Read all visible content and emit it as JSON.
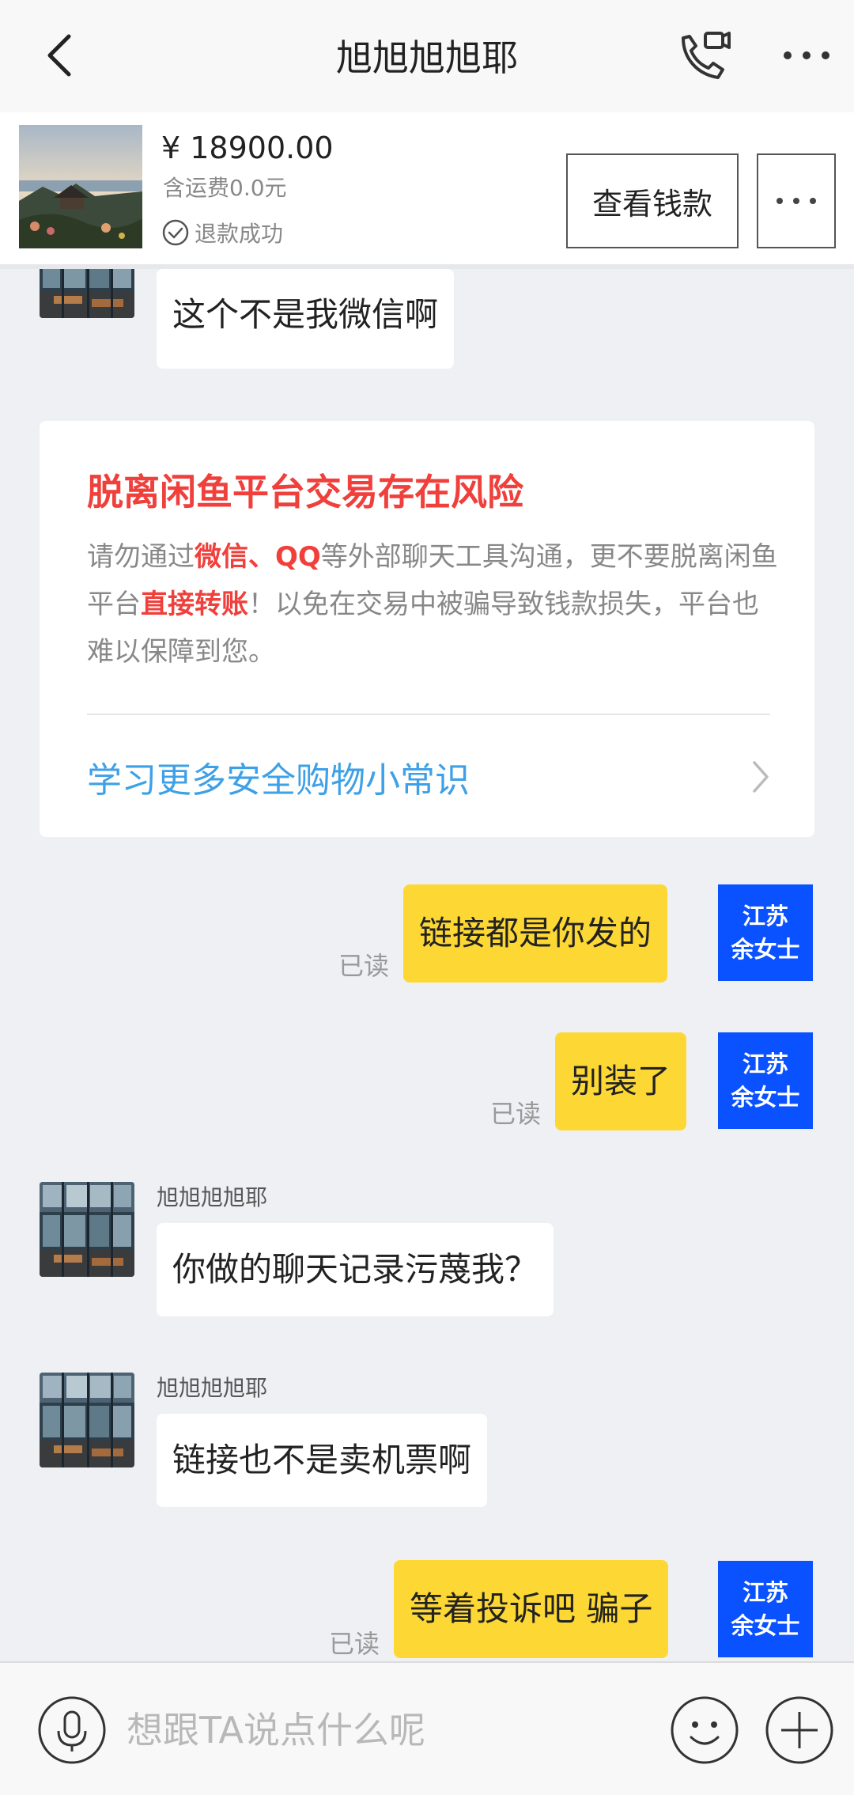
{
  "header": {
    "title": "旭旭旭旭耶",
    "back_icon": "chevron-left-icon",
    "call_icon": "phone-video-icon",
    "more_icon": "more-horizontal-icon"
  },
  "product": {
    "price": "¥ 18900.00",
    "shipping": "含运费0.0元",
    "status": "退款成功",
    "status_icon": "check-circle-icon",
    "view_money_label": "查看钱款",
    "more_icon": "more-horizontal-icon"
  },
  "safety_notice": {
    "title": "脱离闲鱼平台交易存在风险",
    "body_parts": [
      "请勿通过",
      "微信、QQ",
      "等外部聊天工具沟通，更不要脱离闲鱼平台",
      "直接转账",
      "！以免在交易中被骗导致钱款损失，平台也难以保障到您。"
    ],
    "link_label": "学习更多安全购物小常识",
    "link_icon": "chevron-right-icon"
  },
  "messages": [
    {
      "side": "left",
      "sender": "",
      "text": "这个不是我微信啊"
    },
    {
      "side": "right",
      "text": "链接都是你发的",
      "read_label": "已读",
      "avatar_lines": [
        "江苏",
        "余女士"
      ]
    },
    {
      "side": "right",
      "text": "别装了",
      "read_label": "已读",
      "avatar_lines": [
        "江苏",
        "余女士"
      ]
    },
    {
      "side": "left",
      "sender": "旭旭旭旭耶",
      "text": "你做的聊天记录污蔑我？"
    },
    {
      "side": "left",
      "sender": "旭旭旭旭耶",
      "text": "链接也不是卖机票啊"
    },
    {
      "side": "right",
      "text": "等着投诉吧 骗子",
      "read_label": "已读",
      "avatar_lines": [
        "江苏",
        "余女士"
      ]
    }
  ],
  "input_bar": {
    "placeholder": "想跟TA说点什么呢",
    "voice_icon": "microphone-icon",
    "emoji_icon": "smiley-icon",
    "plus_icon": "plus-circle-icon"
  },
  "colors": {
    "accent_red": "#f0403c",
    "link_blue": "#3ea0e6",
    "my_bubble": "#fdd835",
    "avatar_blue": "#0a51ff",
    "chat_bg": "#eff0f4"
  }
}
